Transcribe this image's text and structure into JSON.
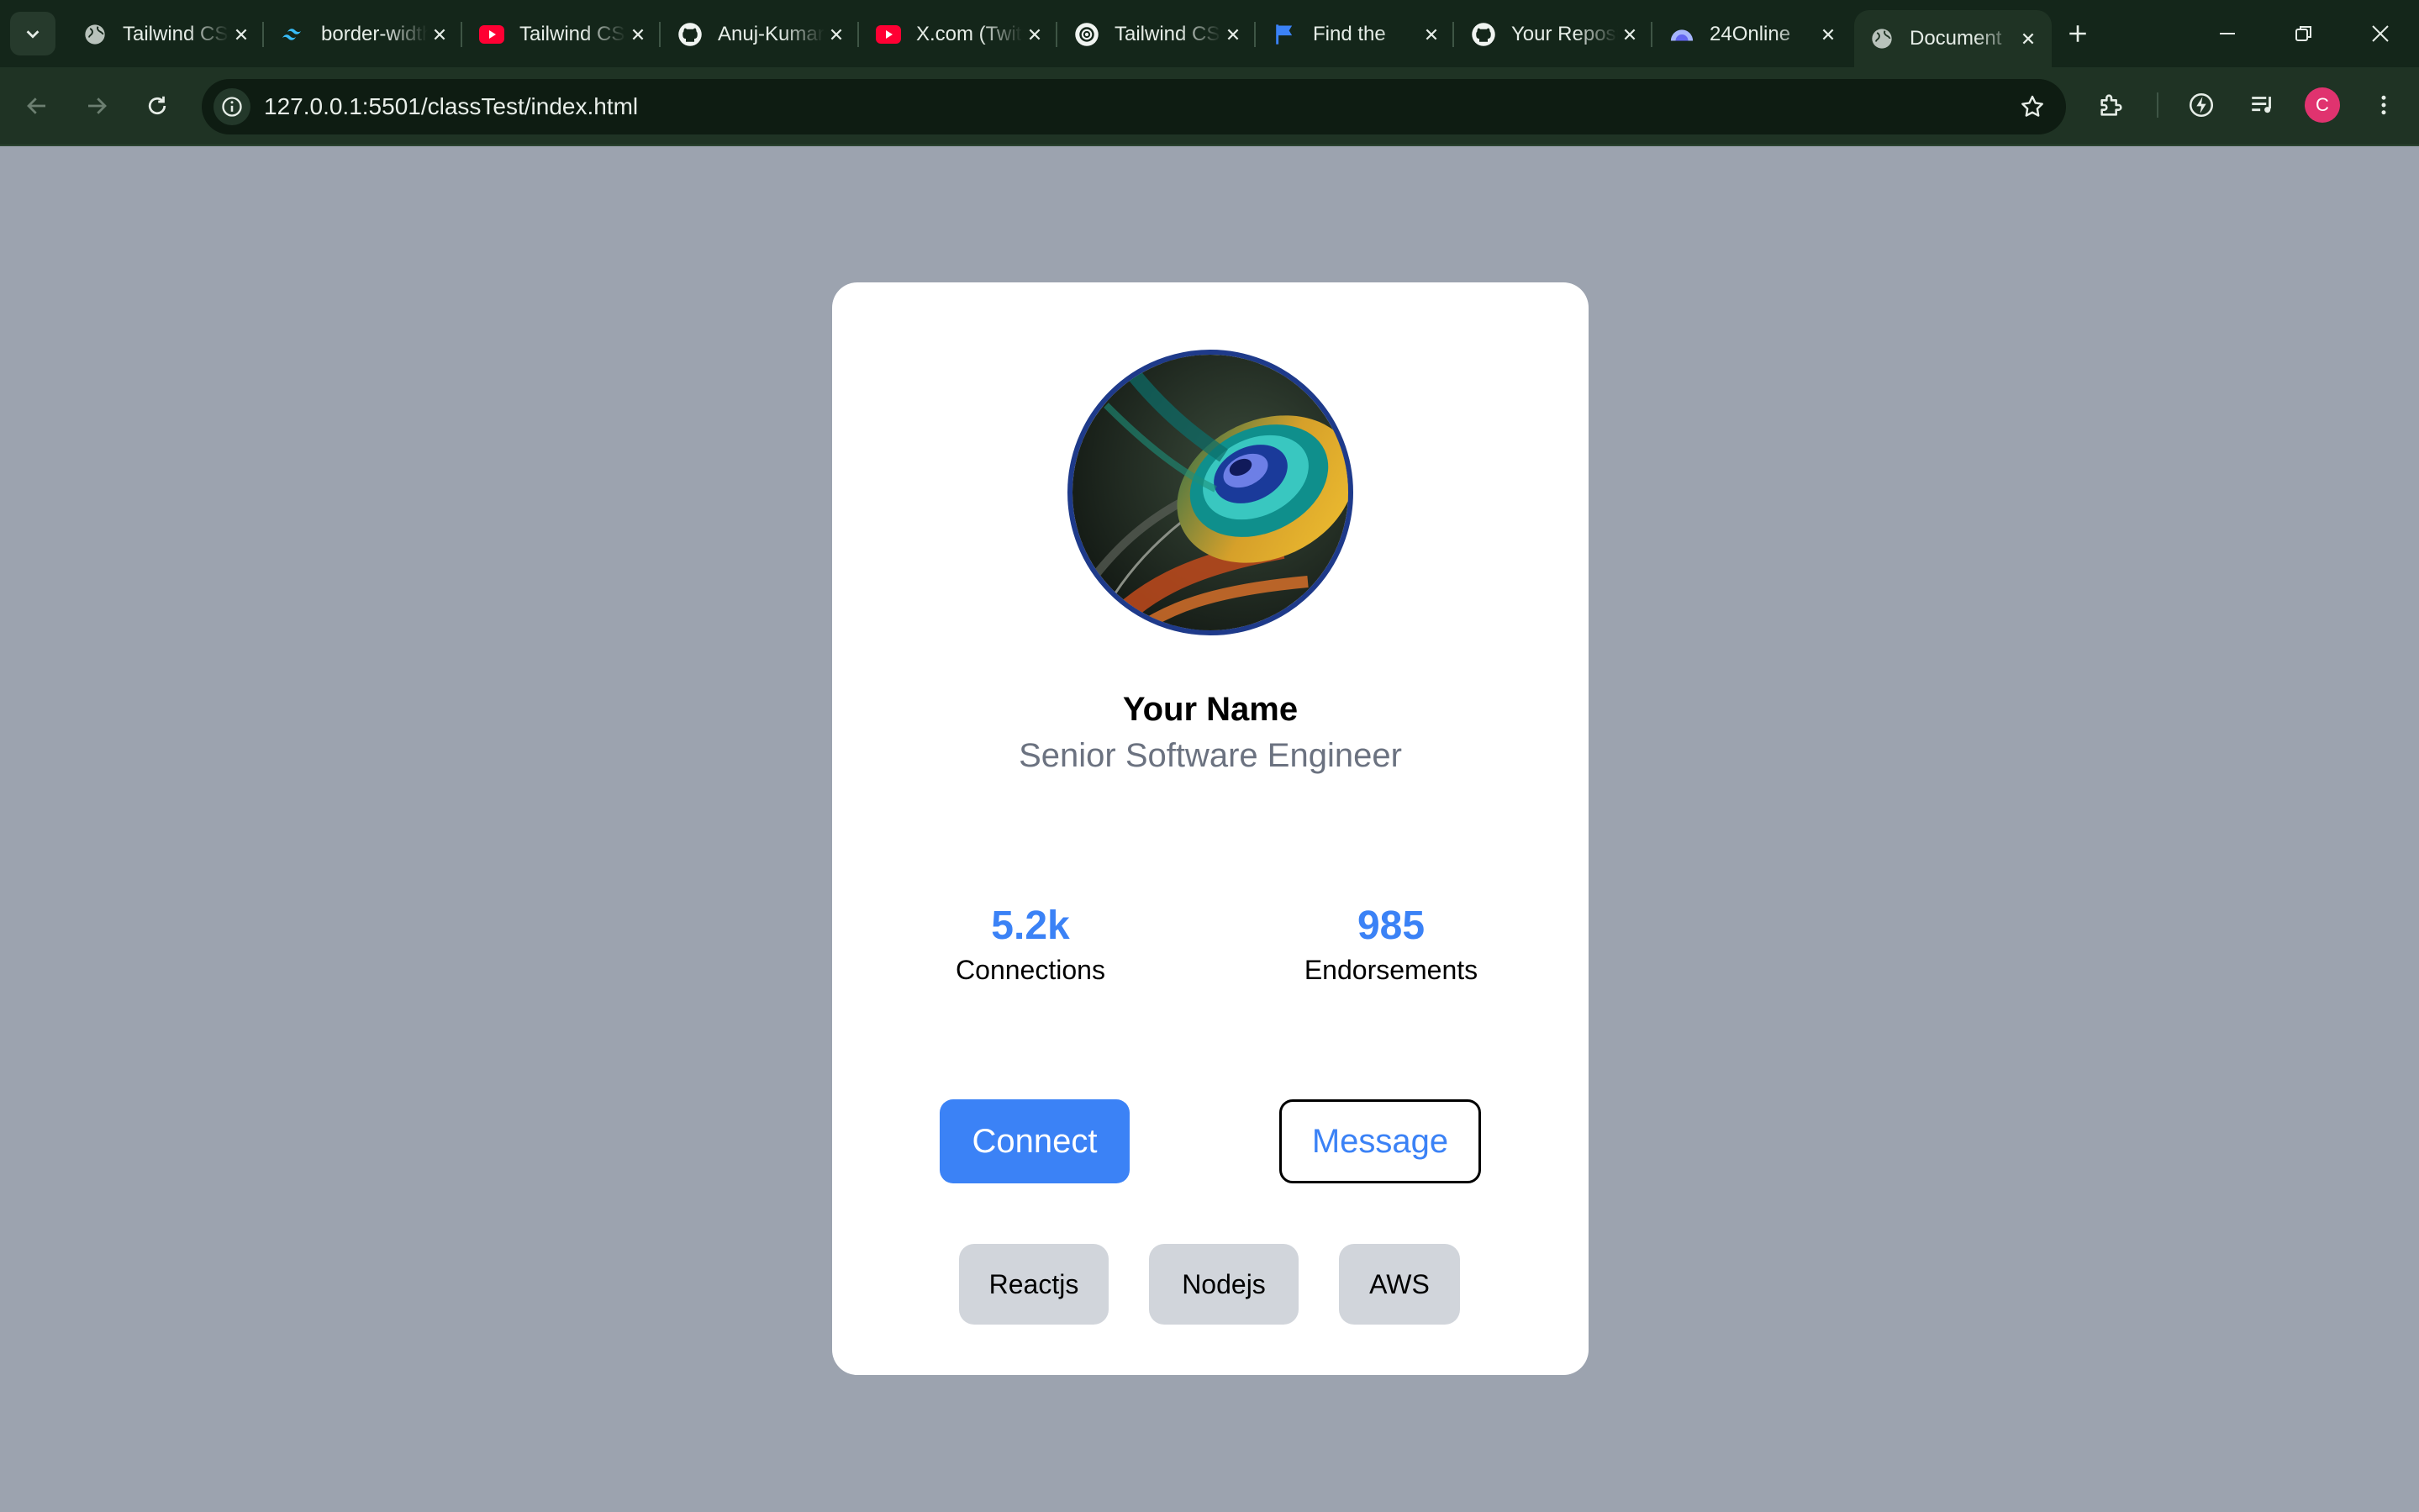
{
  "browser": {
    "tabs": [
      {
        "title": "Tailwind CSS",
        "favicon": "globe-icon"
      },
      {
        "title": "border-width",
        "favicon": "tailwind-icon"
      },
      {
        "title": "Tailwind CSS",
        "favicon": "youtube-icon"
      },
      {
        "title": "Anuj-Kumar",
        "favicon": "github-icon"
      },
      {
        "title": "X.com (Twitter)",
        "favicon": "youtube-icon"
      },
      {
        "title": "Tailwind CSS",
        "favicon": "openai-icon"
      },
      {
        "title": "Find the",
        "favicon": "flag-icon"
      },
      {
        "title": "Your Repositories",
        "favicon": "github-icon"
      },
      {
        "title": "24Online",
        "favicon": "cloud-icon"
      },
      {
        "title": "Document",
        "favicon": "globe-icon",
        "active": true
      }
    ],
    "url": "127.0.0.1:5501/classTest/index.html",
    "profile_initial": "C",
    "colors": {
      "tab_strip": "#14261a",
      "toolbar": "#1f3324",
      "profile": "#e0336f"
    }
  },
  "page": {
    "background": "#9ca3af",
    "card": {
      "name": "Your Name",
      "title": "Senior Software Engineer",
      "stats": [
        {
          "value": "5.2k",
          "label": "Connections"
        },
        {
          "value": "985",
          "label": "Endorsements"
        }
      ],
      "buttons": {
        "connect": "Connect",
        "message": "Message"
      },
      "skills": [
        "Reactjs",
        "Nodejs",
        "AWS"
      ],
      "accent": "#3b82f6",
      "avatar_border": "#1e3a8a"
    }
  }
}
